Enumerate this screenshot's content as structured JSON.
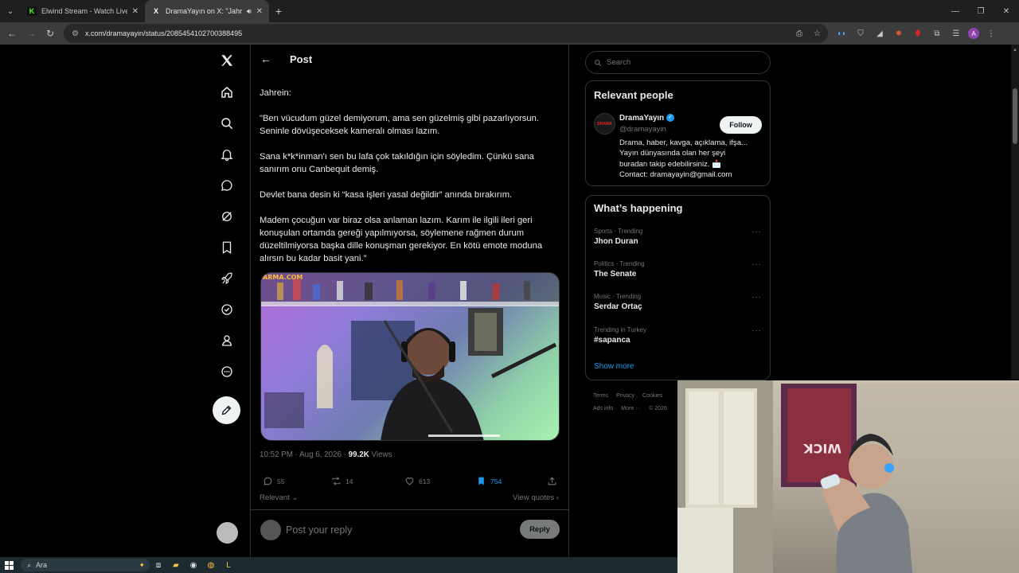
{
  "browser": {
    "tabs": [
      {
        "title": "Elwind Stream - Watch Live on Kick",
        "favicon": "K",
        "favicon_color": "#53fc18",
        "active": false
      },
      {
        "title": "DramaYayın on X: \"Jahrein: \"Ben v",
        "favicon": "X",
        "favicon_color": "#ffffff",
        "active": true
      }
    ],
    "url": "x.com/dramayayin/status/2085454102700388495"
  },
  "post": {
    "header_title": "Post",
    "body": "Jahrein:\n\n\"Ben vücudum güzel demiyorum, ama sen güzelmiş gibi pazarlıyorsun. Seninle dövüşeceksek kameralı olması lazım.\n\nSana k*k*inman'ı sen bu lafa çok takıldığın için söyledim. Çünkü sana sanırım onu Canbequit demiş.\n\nDevlet bana desin ki “kasa işleri yasal değildir” anında bırakırım.\n\nMadem çocuğun var biraz olsa anlaman lazım. Karım ile ilgili ileri geri konuşulan ortamda gereği yapılmıyorsa, söylemene rağmen durum düzeltilmiyorsa başka dille konuşman gerekiyor. En kötü emote moduna alırsın bu kadar basit yani.”",
    "time": "10:52 PM · Aug 6, 2026 · ",
    "views_count": "99.2K",
    "views_label": " Views",
    "replies": "55",
    "reposts": "14",
    "likes": "613",
    "bookmarks": "754",
    "relevant": "Relevant",
    "view_quotes": "View quotes",
    "reply_placeholder": "Post your reply",
    "reply_button": "Reply"
  },
  "sidebar": {
    "search_placeholder": "Search",
    "relevant_people_title": "Relevant people",
    "person": {
      "name": "DramaYayın",
      "handle": "@dramayayin",
      "follow": "Follow",
      "bio": "Drama, haber, kavga, açıklama, ifşa...\nYayın dünyasında olan her şeyi\nburadan takip edebilirsiniz. 📩\nContact: dramayayin@gmail.com"
    },
    "whats_happening_title": "What’s happening",
    "trends": [
      {
        "context": "Sports · Trending",
        "name": "Jhon Duran"
      },
      {
        "context": "Politics · Trending",
        "name": "The Senate"
      },
      {
        "context": "Music · Trending",
        "name": "Serdar Ortaç"
      },
      {
        "context": "Trending in Turkey",
        "name": "#sapanca"
      }
    ],
    "show_more": "Show more",
    "footer": [
      "Terms",
      "Privacy",
      "Cookies",
      "Ads info",
      "More ···",
      "© 2026"
    ]
  },
  "taskbar": {
    "search_text": "Ara"
  },
  "colors": {
    "accent": "#1d9bf0",
    "bookmark_active": "#1d9bf0"
  }
}
